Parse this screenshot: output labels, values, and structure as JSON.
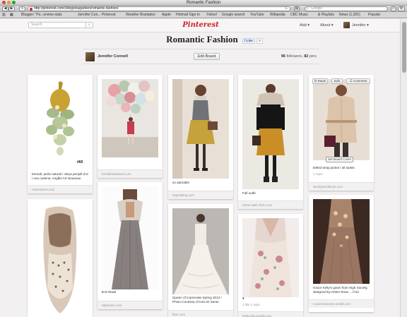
{
  "window": {
    "title": "Romantic Fashion"
  },
  "browser": {
    "back_label": "◀",
    "forward_label": "▶",
    "add_label": "+",
    "url": "http://pinterest.com/3dogsinagarden/romantic-fashion/",
    "reload_label": "C",
    "search_placeholder": "Google"
  },
  "bookmarks": [
    "Blogger: Thr...erview stats",
    "Jennifer Con...  Pinterest",
    "Weather Brampton",
    "Apple",
    "Hotmail Sign In",
    "Yahoo!",
    "Google search",
    "YouTube",
    "Wikipedia",
    "CBC Music",
    "& Playlists",
    "News (1,925)",
    "Popular"
  ],
  "header": {
    "search_placeholder": "Search",
    "logo": "Pinterest",
    "add_label": "Add",
    "about_label": "About",
    "user_label": "Jennifer"
  },
  "board": {
    "title": "Romantic Fashion",
    "like_label": "Like",
    "like_count": "0",
    "owner": "Jennifer Connell",
    "edit_label": "Edit Board",
    "followers_count": "96",
    "followers_label": "followers,",
    "pins_count": "82",
    "pins_label": "pins"
  },
  "overlay": {
    "repin": "Repin",
    "edit": "Edit",
    "comment": "Comment",
    "set_cover": "Set Board Cover"
  },
  "pins": [
    {
      "caption": "Esmalt, perla natural i vitrya penjoll d'or i una cadena. Anglès Art Nouveau",
      "source": "natsosartes.com",
      "overlay_text": "#69"
    },
    {
      "caption": "",
      "source": "breakfastattowel.com"
    },
    {
      "caption": "so adorable",
      "source": "bepinkblog.com"
    },
    {
      "caption": "Fall outfit",
      "source": "farm3.static.flickr.com"
    },
    {
      "caption": "belted wrap jacket / all saints",
      "meta": "1 repin",
      "source": "wendyslookbook.com"
    },
    {
      "caption": "",
      "source": ""
    },
    {
      "caption": "knit shawl",
      "source": "elfpstudio.com"
    },
    {
      "caption": "Queen of Carnevale Spring 2013 / Photo Courtesy of Ines Di Santo",
      "source": "flare.com"
    },
    {
      "caption": "♥",
      "meta": "1 like   1 repin",
      "source": "kathychiu.tumblr.com"
    },
    {
      "caption": "Grace Kelly's gown from High Society, designed by Helen Rose.....l'md",
      "source": "moviecostumes.tumblr.com"
    }
  ],
  "colors": {
    "brand": "#cb2027",
    "facebook": "#3b5998"
  }
}
